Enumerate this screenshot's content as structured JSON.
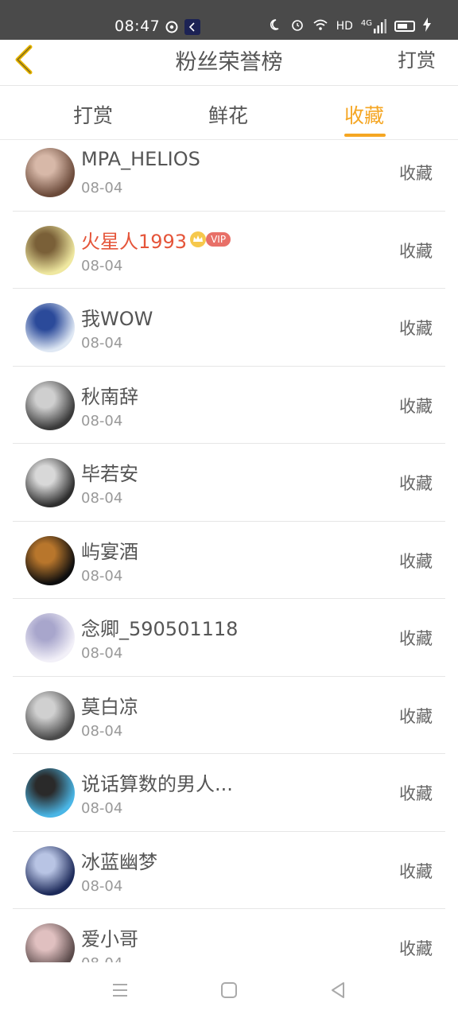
{
  "status": {
    "time": "08:47",
    "net_label": "HD",
    "signal_label": "4G"
  },
  "header": {
    "title": "粉丝荣誉榜",
    "right_label": "打赏"
  },
  "tabs": [
    {
      "label": "打赏",
      "active": false
    },
    {
      "label": "鲜花",
      "active": false
    },
    {
      "label": "收藏",
      "active": true
    }
  ],
  "colors": {
    "accent": "#f5a623",
    "vip_name": "#e5553a",
    "vip_badge": "#e87068"
  },
  "fans": [
    {
      "name": "MPA_HELIOS",
      "date": "08-04",
      "action": "收藏",
      "avatar": [
        "#6b4a3a",
        "#d7b8a8"
      ]
    },
    {
      "name": "火星人1993",
      "date": "08-04",
      "action": "收藏",
      "vip": true,
      "vip_label": "VIP",
      "avatar": [
        "#efe8a0",
        "#7a6038"
      ]
    },
    {
      "name": "我WOW",
      "date": "08-04",
      "action": "收藏",
      "avatar": [
        "#dfe8f4",
        "#2b4a9a"
      ]
    },
    {
      "name": "秋南辞",
      "date": "08-04",
      "action": "收藏",
      "avatar": [
        "#3a3a3a",
        "#cfcfcf"
      ]
    },
    {
      "name": "毕若安",
      "date": "08-04",
      "action": "收藏",
      "avatar": [
        "#2e2e2e",
        "#d8d8d8"
      ]
    },
    {
      "name": "屿宴酒",
      "date": "08-04",
      "action": "收藏",
      "avatar": [
        "#0e0e0e",
        "#b8762c"
      ]
    },
    {
      "name": "念卿_590501118",
      "date": "08-04",
      "action": "收藏",
      "avatar": [
        "#f2f0f8",
        "#a8a6cc"
      ]
    },
    {
      "name": "莫白凉",
      "date": "08-04",
      "action": "收藏",
      "avatar": [
        "#4a4a4a",
        "#d0d0d0"
      ]
    },
    {
      "name": "说话算数的男人...",
      "date": "08-04",
      "action": "收藏",
      "avatar": [
        "#4ab6e6",
        "#2a2a2a"
      ]
    },
    {
      "name": "冰蓝幽梦",
      "date": "08-04",
      "action": "收藏",
      "avatar": [
        "#1d2a5a",
        "#b8c4e4"
      ]
    },
    {
      "name": "爱小哥",
      "date": "08-04",
      "action": "收藏",
      "avatar": [
        "#5a4a4a",
        "#e0c0c0"
      ]
    }
  ]
}
